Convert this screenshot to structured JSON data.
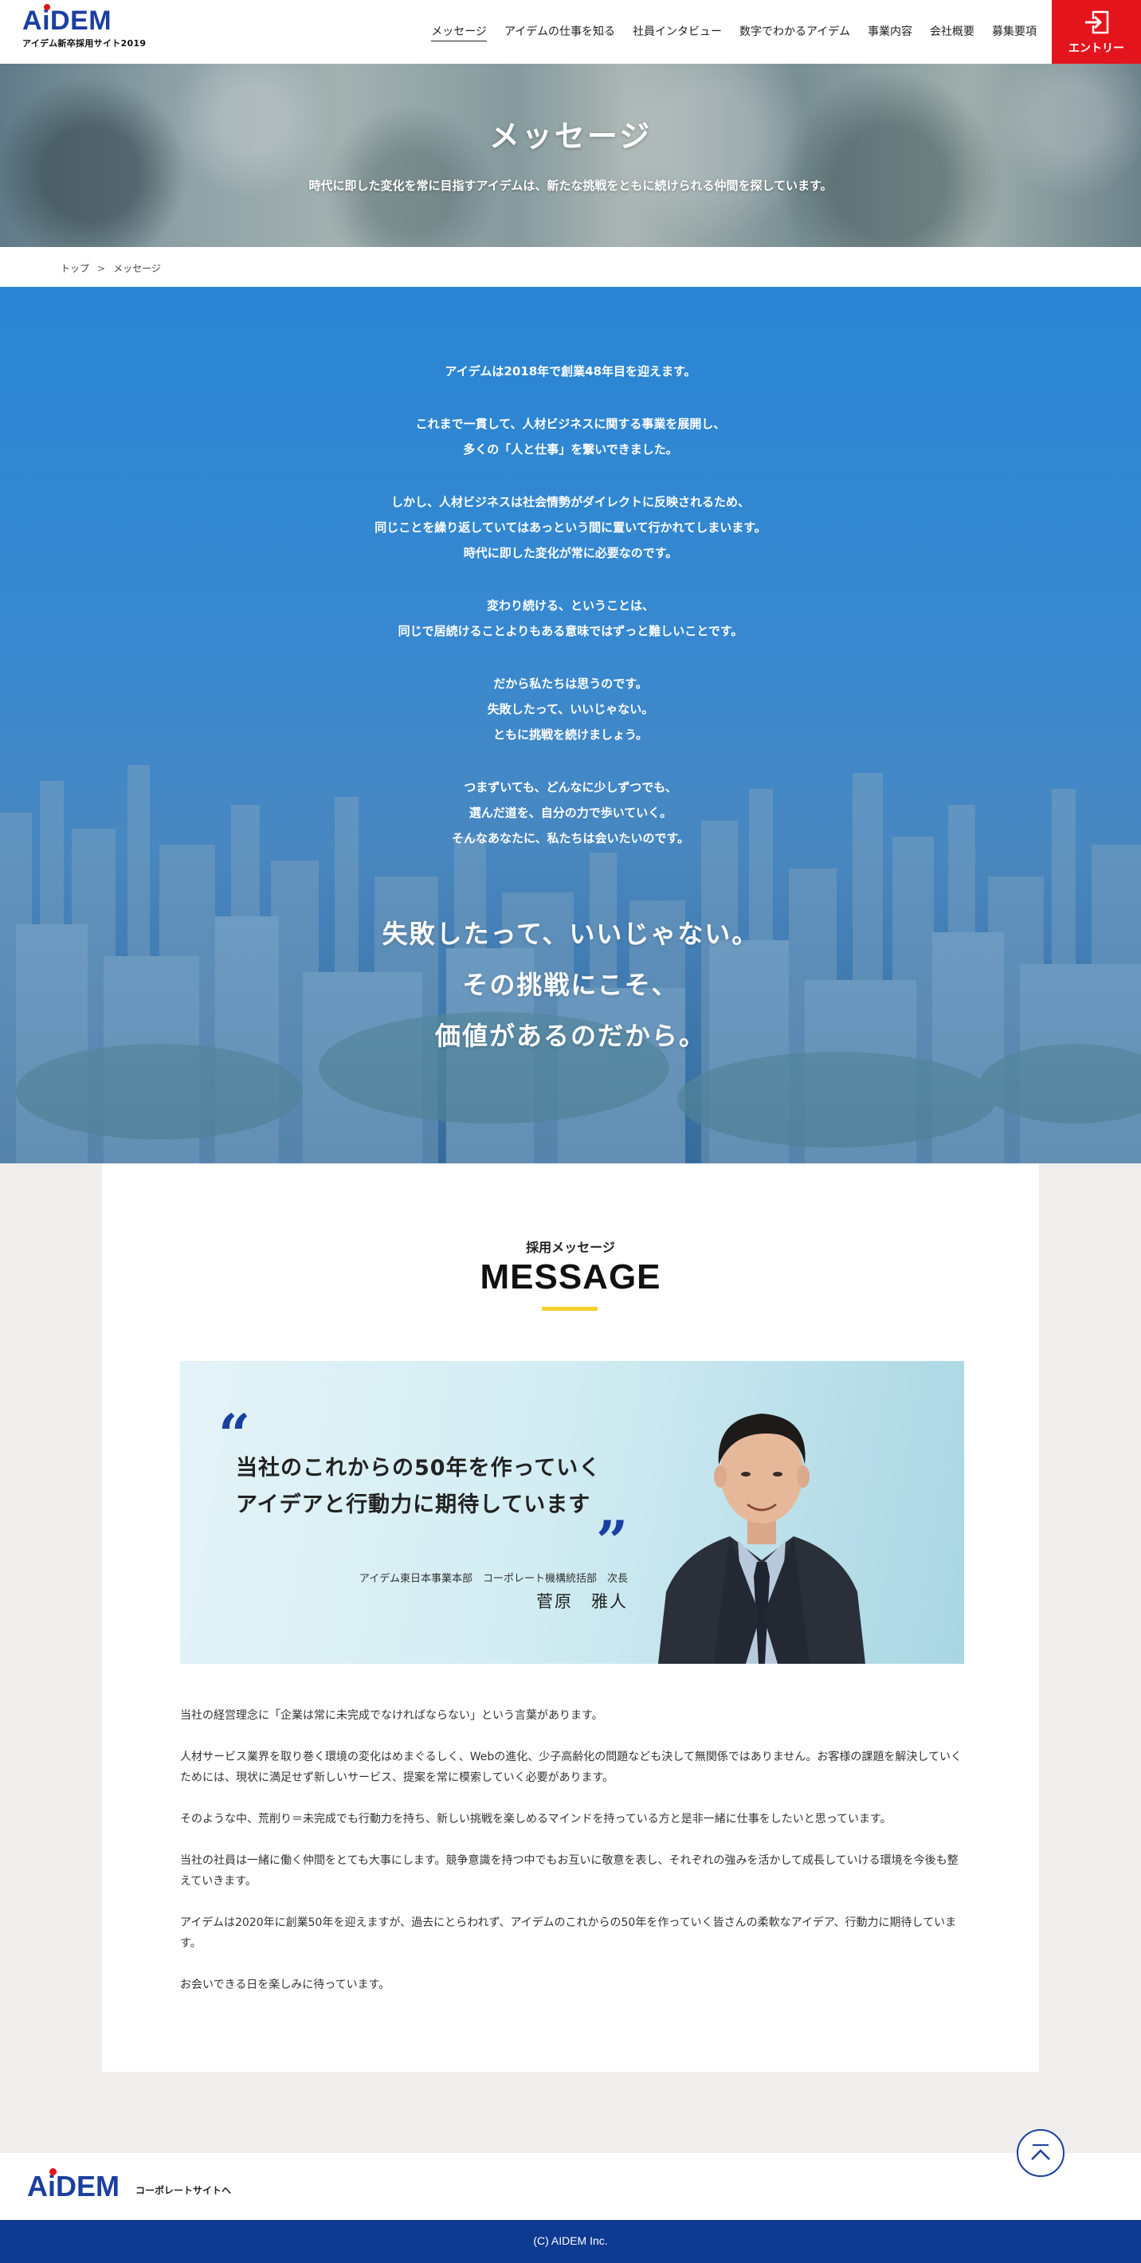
{
  "header": {
    "logo_text_a": "A",
    "logo_text_i": "i",
    "logo_text_rest": "DEM",
    "logo_subtitle": "アイデム新卒採用サイト2019",
    "nav": [
      {
        "label": "メッセージ",
        "active": true
      },
      {
        "label": "アイデムの仕事を知る"
      },
      {
        "label": "社員インタビュー"
      },
      {
        "label": "数字でわかるアイデム"
      },
      {
        "label": "事業内容"
      },
      {
        "label": "会社概要"
      },
      {
        "label": "募集要項"
      }
    ],
    "entry_label": "エントリー"
  },
  "hero": {
    "title": "メッセージ",
    "subtitle": "時代に即した変化を常に目指すアイデムは、新たな挑戦をともに続けられる仲間を探しています。"
  },
  "breadcrumb": {
    "home": "トップ",
    "separator": ">",
    "current": "メッセージ"
  },
  "band": {
    "paragraphs": [
      [
        "アイデムは2018年で創業48年目を迎えます。"
      ],
      [
        "これまで一貫して、人材ビジネスに関する事業を展開し、",
        "多くの「人と仕事」を繋いできました。"
      ],
      [
        "しかし、人材ビジネスは社会情勢がダイレクトに反映されるため、",
        "同じことを繰り返していてはあっという間に置いて行かれてしまいます。",
        "時代に即した変化が常に必要なのです。"
      ],
      [
        "変わり続ける、ということは、",
        "同じで居続けることよりもある意味ではずっと難しいことです。"
      ],
      [
        "だから私たちは思うのです。",
        "失敗したって、いいじゃない。",
        "ともに挑戦を続けましょう。"
      ],
      [
        "つまずいても、どんなに少しずつでも、",
        "選んだ道を、自分の力で歩いていく。",
        "そんなあなたに、私たちは会いたいのです。"
      ]
    ],
    "catch": [
      "失敗したって、いいじゃない。",
      "その挑戦にこそ、",
      "価値があるのだから。"
    ]
  },
  "message": {
    "kicker": "採用メッセージ",
    "heading": "MESSAGE",
    "quote_open": "“",
    "quote_close": "”",
    "quote_lines": [
      "当社のこれからの50年を作っていく",
      "アイデアと行動力に期待しています"
    ],
    "author_title": "アイデム東日本事業本部　コーポレート機構統括部　次長",
    "author_name": "菅原　雅人",
    "body": [
      "当社の経営理念に「企業は常に未完成でなければならない」という言葉があります。",
      "人材サービス業界を取り巻く環境の変化はめまぐるしく、Webの進化、少子高齢化の問題なども決して無関係ではありません。お客様の課題を解決していくためには、現状に満足せず新しいサービス、提案を常に模索していく必要があります。",
      "そのような中、荒削り＝未完成でも行動力を持ち、新しい挑戦を楽しめるマインドを持っている方と是非一緒に仕事をしたいと思っています。",
      "当社の社員は一緒に働く仲間をとても大事にします。競争意識を持つ中でもお互いに敬意を表し、それぞれの強みを活かして成長していける環境を今後も整えていきます。",
      "アイデムは2020年に創業50年を迎えますが、過去にとらわれず、アイデムのこれからの50年を作っていく皆さんの柔軟なアイデア、行動力に期待しています。",
      "お会いできる日を楽しみに待っています。"
    ]
  },
  "footer": {
    "corporate_link": "コーポレートサイトへ",
    "copyright": "(C) AIDEM Inc."
  },
  "colors": {
    "brand_blue": "#1b3fa0",
    "entry_red": "#e4141d",
    "accent_yellow": "#f4d12a",
    "footer_navy": "#0f3a92"
  },
  "icons": {
    "entry": "enter-arrow-icon",
    "pagetop": "chevron-up-icon"
  }
}
